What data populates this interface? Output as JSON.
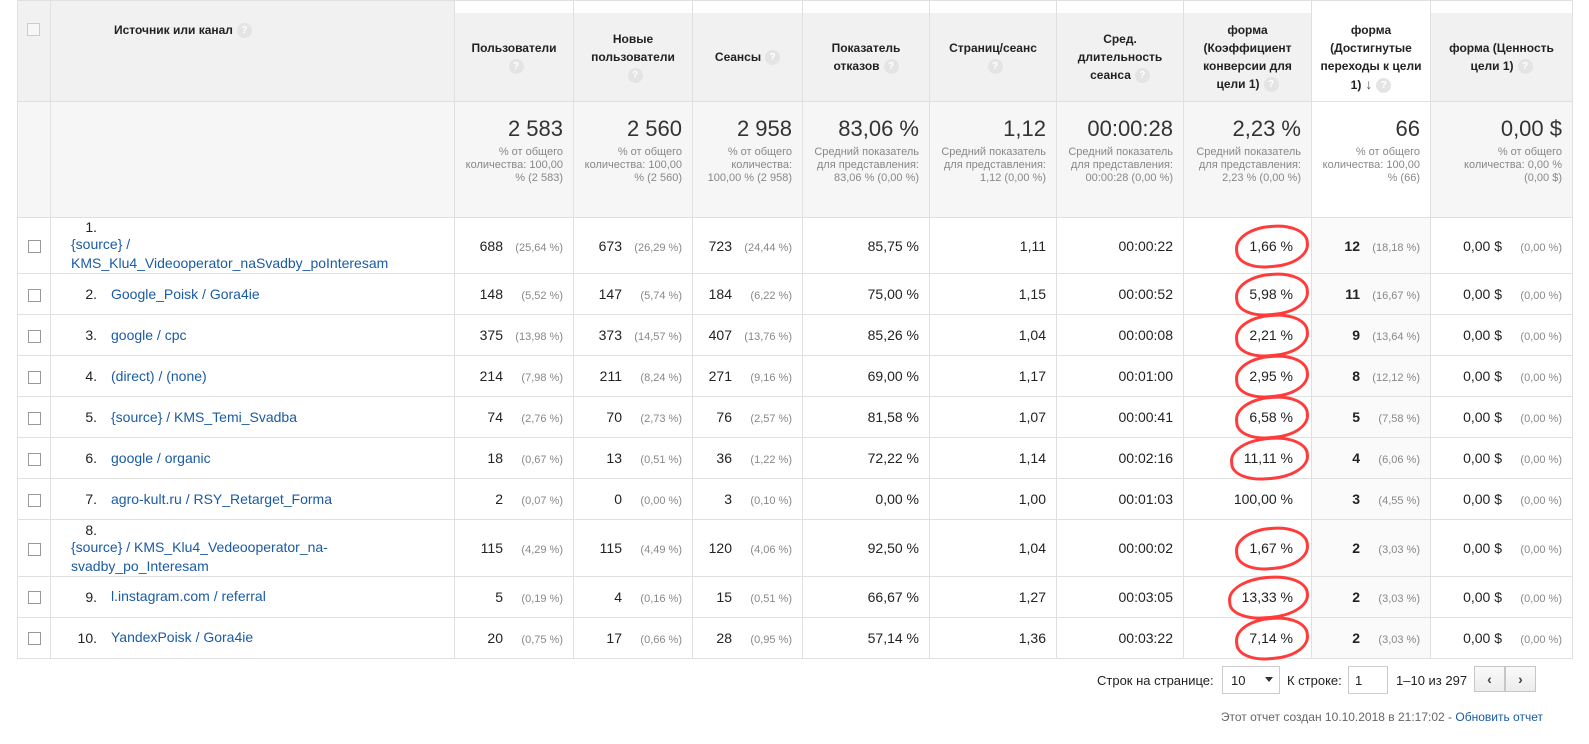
{
  "header": {
    "source": "Источник или канал",
    "users": "Пользователи",
    "new_users": "Новые пользователи",
    "sessions": "Сеансы",
    "bounce": "Показатель отказов",
    "pages": "Страниц/сеанс",
    "duration": "Сред. длительность сеанса",
    "conv_rate": "форма (Коэффициент конверсии для цели 1)",
    "completions": "форма (Достигнутые переходы к цели 1)",
    "value": "форма (Ценность цели 1)",
    "help_icon": "?"
  },
  "summary": {
    "users": {
      "value": "2 583",
      "sub": "% от общего количества: 100,00 % (2 583)"
    },
    "new_users": {
      "value": "2 560",
      "sub": "% от общего количества: 100,00 % (2 560)"
    },
    "sessions": {
      "value": "2 958",
      "sub": "% от общего количества: 100,00 % (2 958)"
    },
    "bounce": {
      "value": "83,06 %",
      "sub": "Средний показатель для представления: 83,06 % (0,00 %)"
    },
    "pages": {
      "value": "1,12",
      "sub": "Средний показатель для представления: 1,12 (0,00 %)"
    },
    "duration": {
      "value": "00:00:28",
      "sub": "Средний показатель для представления: 00:00:28 (0,00 %)"
    },
    "conv_rate": {
      "value": "2,23 %",
      "sub": "Средний показатель для представления: 2,23 % (0,00 %)"
    },
    "completions": {
      "value": "66",
      "sub": "% от общего количества: 100,00 % (66)"
    },
    "value": {
      "value": "0,00 $",
      "sub": "% от общего количества: 0,00 % (0,00 $)"
    }
  },
  "rows": [
    {
      "n": "1.",
      "source": "{source} / KMS_Klu4_Videooperator_naSvadby_poInteresam",
      "users": "688",
      "users_pct": "(25,64 %)",
      "new_users": "673",
      "new_users_pct": "(26,29 %)",
      "sessions": "723",
      "sessions_pct": "(24,44 %)",
      "bounce": "85,75 %",
      "pages": "1,11",
      "duration": "00:00:22",
      "conv_rate": "1,66 %",
      "completions": "12",
      "completions_pct": "(18,18 %)",
      "value": "0,00 $",
      "value_pct": "(0,00 %)"
    },
    {
      "n": "2.",
      "source": "Google_Poisk / Gora4ie",
      "users": "148",
      "users_pct": "(5,52 %)",
      "new_users": "147",
      "new_users_pct": "(5,74 %)",
      "sessions": "184",
      "sessions_pct": "(6,22 %)",
      "bounce": "75,00 %",
      "pages": "1,15",
      "duration": "00:00:52",
      "conv_rate": "5,98 %",
      "completions": "11",
      "completions_pct": "(16,67 %)",
      "value": "0,00 $",
      "value_pct": "(0,00 %)"
    },
    {
      "n": "3.",
      "source": "google / cpc",
      "users": "375",
      "users_pct": "(13,98 %)",
      "new_users": "373",
      "new_users_pct": "(14,57 %)",
      "sessions": "407",
      "sessions_pct": "(13,76 %)",
      "bounce": "85,26 %",
      "pages": "1,04",
      "duration": "00:00:08",
      "conv_rate": "2,21 %",
      "completions": "9",
      "completions_pct": "(13,64 %)",
      "value": "0,00 $",
      "value_pct": "(0,00 %)"
    },
    {
      "n": "4.",
      "source": "(direct) / (none)",
      "users": "214",
      "users_pct": "(7,98 %)",
      "new_users": "211",
      "new_users_pct": "(8,24 %)",
      "sessions": "271",
      "sessions_pct": "(9,16 %)",
      "bounce": "69,00 %",
      "pages": "1,17",
      "duration": "00:01:00",
      "conv_rate": "2,95 %",
      "completions": "8",
      "completions_pct": "(12,12 %)",
      "value": "0,00 $",
      "value_pct": "(0,00 %)"
    },
    {
      "n": "5.",
      "source": "{source} / KMS_Temi_Svadba",
      "users": "74",
      "users_pct": "(2,76 %)",
      "new_users": "70",
      "new_users_pct": "(2,73 %)",
      "sessions": "76",
      "sessions_pct": "(2,57 %)",
      "bounce": "81,58 %",
      "pages": "1,07",
      "duration": "00:00:41",
      "conv_rate": "6,58 %",
      "completions": "5",
      "completions_pct": "(7,58 %)",
      "value": "0,00 $",
      "value_pct": "(0,00 %)"
    },
    {
      "n": "6.",
      "source": "google / organic",
      "users": "18",
      "users_pct": "(0,67 %)",
      "new_users": "13",
      "new_users_pct": "(0,51 %)",
      "sessions": "36",
      "sessions_pct": "(1,22 %)",
      "bounce": "72,22 %",
      "pages": "1,14",
      "duration": "00:02:16",
      "conv_rate": "11,11 %",
      "completions": "4",
      "completions_pct": "(6,06 %)",
      "value": "0,00 $",
      "value_pct": "(0,00 %)"
    },
    {
      "n": "7.",
      "source": "agro-kult.ru / RSY_Retarget_Forma",
      "users": "2",
      "users_pct": "(0,07 %)",
      "new_users": "0",
      "new_users_pct": "(0,00 %)",
      "sessions": "3",
      "sessions_pct": "(0,10 %)",
      "bounce": "0,00 %",
      "pages": "1,00",
      "duration": "00:01:03",
      "conv_rate": "100,00 %",
      "completions": "3",
      "completions_pct": "(4,55 %)",
      "value": "0,00 $",
      "value_pct": "(0,00 %)"
    },
    {
      "n": "8.",
      "source": "{source} / KMS_Klu4_Vedeooperator_na-svadby_po_Interesam",
      "users": "115",
      "users_pct": "(4,29 %)",
      "new_users": "115",
      "new_users_pct": "(4,49 %)",
      "sessions": "120",
      "sessions_pct": "(4,06 %)",
      "bounce": "92,50 %",
      "pages": "1,04",
      "duration": "00:00:02",
      "conv_rate": "1,67 %",
      "completions": "2",
      "completions_pct": "(3,03 %)",
      "value": "0,00 $",
      "value_pct": "(0,00 %)"
    },
    {
      "n": "9.",
      "source": "l.instagram.com / referral",
      "users": "5",
      "users_pct": "(0,19 %)",
      "new_users": "4",
      "new_users_pct": "(0,16 %)",
      "sessions": "15",
      "sessions_pct": "(0,51 %)",
      "bounce": "66,67 %",
      "pages": "1,27",
      "duration": "00:03:05",
      "conv_rate": "13,33 %",
      "completions": "2",
      "completions_pct": "(3,03 %)",
      "value": "0,00 $",
      "value_pct": "(0,00 %)"
    },
    {
      "n": "10.",
      "source": "YandexPoisk / Gora4ie",
      "users": "20",
      "users_pct": "(0,75 %)",
      "new_users": "17",
      "new_users_pct": "(0,66 %)",
      "sessions": "28",
      "sessions_pct": "(0,95 %)",
      "bounce": "57,14 %",
      "pages": "1,36",
      "duration": "00:03:22",
      "conv_rate": "7,14 %",
      "completions": "2",
      "completions_pct": "(3,03 %)",
      "value": "0,00 $",
      "value_pct": "(0,00 %)"
    }
  ],
  "pagination": {
    "rows_label": "Строк на странице:",
    "rows_value": "10",
    "goto_label": "К строке:",
    "goto_value": "1",
    "range": "1–10 из 297",
    "prev": "‹",
    "next": "›"
  },
  "footer": {
    "created": "Этот отчет создан 10.10.2018 в 21:17:02 -",
    "refresh": "Обновить отчет"
  },
  "colors": {
    "link": "#1a5ba6",
    "annotation": "#ff3b3b"
  }
}
